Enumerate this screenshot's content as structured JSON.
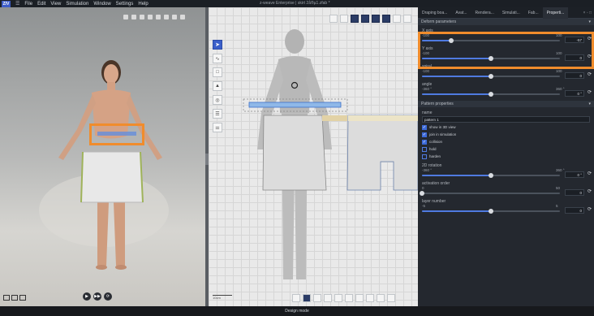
{
  "app": {
    "logo": "Z/V",
    "menu": [
      "File",
      "Edit",
      "View",
      "Simulation",
      "Window",
      "Settings",
      "Help"
    ],
    "window_title": "z-weave Enterprise | skirt 2å®µ1.zfab *"
  },
  "viewer3d": {
    "play_buttons": [
      "▶",
      "▶▶",
      "⟳"
    ]
  },
  "viewer2d": {
    "scale_label": "10cm"
  },
  "panel": {
    "tabs": [
      "Draping boa...",
      "Avat...",
      "Rendera...",
      "Simulati...",
      "Fab...",
      "Properti..."
    ],
    "active_tab": "Properti...",
    "section_deform": "Deform parameters",
    "x_axis": {
      "label": "X axis",
      "min": "-100",
      "max": "100",
      "value": "-57",
      "fraction": 0.21
    },
    "y_axis": {
      "label": "Y axis",
      "min": "-100",
      "max": "100",
      "value": "0",
      "fraction": 0.5
    },
    "spiral": {
      "label": "spiral",
      "min": "-100",
      "max": "100",
      "value": "0",
      "fraction": 0.5
    },
    "angle": {
      "label": "angle",
      "min": "-360 °",
      "max": "360 °",
      "value": "0 °",
      "fraction": 0.5
    },
    "section_pattern": "Pattern properties",
    "name_label": "name",
    "name_value": "pattern 1",
    "checkboxes": [
      {
        "label": "show in 3D view",
        "checked": true
      },
      {
        "label": "join in simulation",
        "checked": true
      },
      {
        "label": "collision",
        "checked": true
      },
      {
        "label": "hold",
        "checked": false
      },
      {
        "label": "harden",
        "checked": false
      }
    ],
    "rotation_2d": {
      "label": "2D rotation",
      "min": "-360 °",
      "max": "360 °",
      "value": "0 °",
      "fraction": 0.5
    },
    "activation_order": {
      "label": "activation order",
      "min": "0",
      "max": "50",
      "value": "0",
      "fraction": 0.0
    },
    "layer_number": {
      "label": "layer number",
      "min": "-5",
      "max": "5",
      "value": "0",
      "fraction": 0.5
    }
  },
  "status_bar": {
    "text": "Design mode"
  },
  "colors": {
    "accent": "#4f7ae0",
    "highlight": "#f08c2c"
  }
}
